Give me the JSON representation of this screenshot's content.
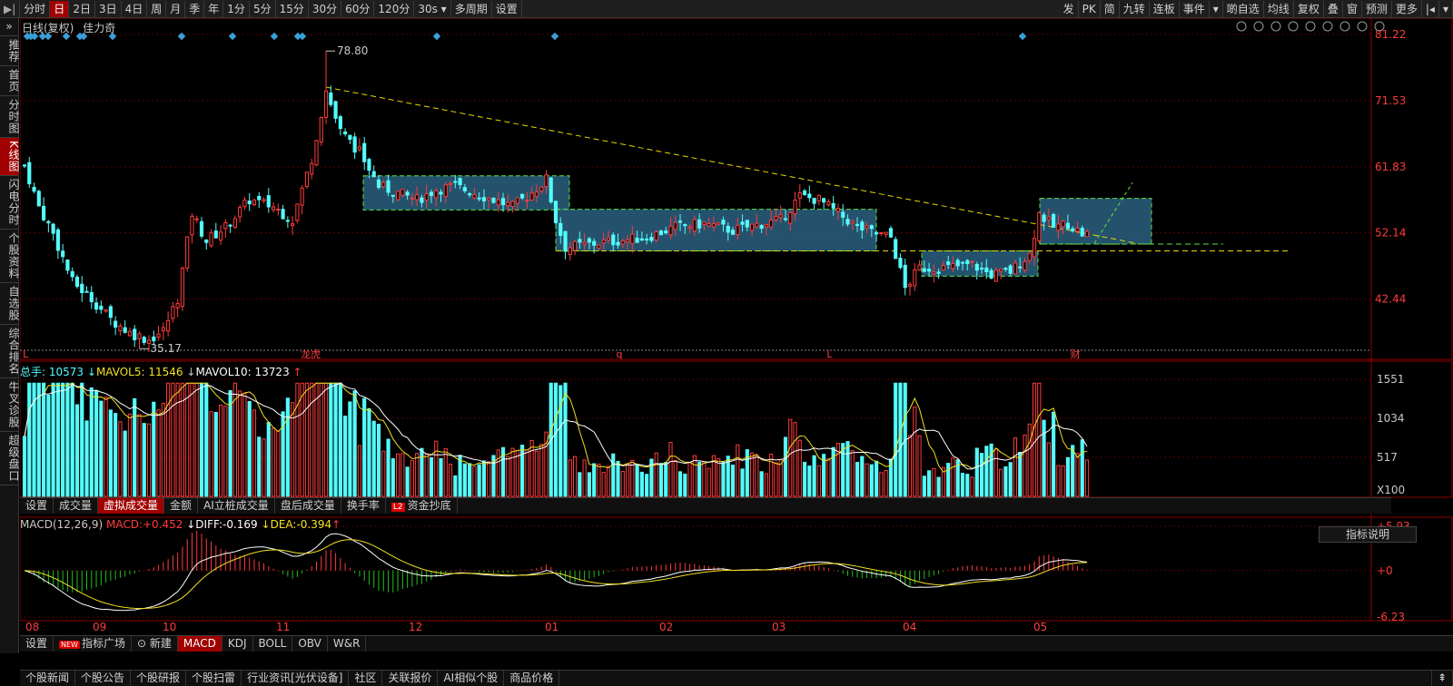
{
  "toolbar": {
    "left": [
      "分时",
      "日",
      "2日",
      "3日",
      "4日",
      "周",
      "月",
      "季",
      "年",
      "1分",
      "5分",
      "15分",
      "30分",
      "60分",
      "120分",
      "30s ▾",
      "多周期",
      "设置"
    ],
    "active": "日",
    "right": [
      "发",
      "PK",
      "简",
      "九转",
      "连板",
      "事件",
      "▾",
      "啲自选",
      "均线",
      "复权",
      "叠",
      "窗",
      "预测",
      "更多",
      "|◂",
      "▾"
    ]
  },
  "sidebar": [
    {
      "label": "推荐"
    },
    {
      "label": "首页"
    },
    {
      "label": "分时图"
    },
    {
      "label": "K线图",
      "active": true
    },
    {
      "label": "闪电分时"
    },
    {
      "label": "个股资料"
    },
    {
      "label": "自选股"
    },
    {
      "label": "综合排名"
    },
    {
      "label": "牛叉诊股"
    },
    {
      "label": "超级盘口"
    }
  ],
  "header": {
    "mode": "日线(复权)",
    "stock": "佳力奇"
  },
  "header_icons": [
    "settings-icon",
    "brush-icon",
    "eye-icon",
    "headset-icon",
    "copy-icon",
    "lock-icon",
    "zoom-in-icon",
    "zoom-out-icon",
    "close-icon"
  ],
  "price_axis": [
    "81.22",
    "71.53",
    "61.83",
    "52.14",
    "42.44"
  ],
  "markers": {
    "high": "78.80",
    "low": "35.17"
  },
  "event_labels": [
    {
      "x": 0.002,
      "t": "L"
    },
    {
      "x": 0.196,
      "t": "龙虎"
    },
    {
      "x": 0.416,
      "t": "q"
    },
    {
      "x": 0.563,
      "t": "L"
    },
    {
      "x": 0.733,
      "t": "财"
    }
  ],
  "volume": {
    "label": "总手: 10573",
    "mavol5_label": "MAVOL5:",
    "mavol5": "11546",
    "mavol10_label": "MAVOL10:",
    "mavol10": "13723",
    "axis": [
      "1551",
      "1034",
      "517"
    ],
    "unit": "X100"
  },
  "vol_tabs": [
    "设置",
    "成交量",
    "虚拟成交量",
    "金额",
    "AI立桩成交量",
    "盘后成交量",
    "换手率",
    "资金抄底"
  ],
  "vol_tab_active": "虚拟成交量",
  "l2_tag": "L2",
  "macd": {
    "label": "MACD(12,26,9)",
    "macd_label": "MACD:",
    "macd": "+0.452",
    "diff_label": "DIFF:",
    "diff": "-0.169",
    "dea_label": "DEA:",
    "dea": "-0.394",
    "axis": [
      "+5.93",
      "+0",
      "-6.23"
    ]
  },
  "explain_button": "指标说明",
  "months": [
    "08",
    "09",
    "10",
    "11",
    "12",
    "01",
    "02",
    "03",
    "04",
    "05"
  ],
  "ind_tabs": [
    "设置",
    "指标广场",
    "新建",
    "MACD",
    "KDJ",
    "BOLL",
    "OBV",
    "W&R"
  ],
  "ind_tab_active": "MACD",
  "new_tag": "NEW",
  "bottom_tabs": [
    "个股新闻",
    "个股公告",
    "个股研报",
    "个股扫雷",
    "行业资讯[光伏设备]",
    "社区",
    "关联报价",
    "AI相似个股",
    "商品价格"
  ],
  "colors": {
    "up": "#ff3b3b",
    "down": "#54fcfc",
    "ma5": "#ffffff",
    "ma10": "#f0e020",
    "box": "#2a6080",
    "boxline": "#60e040",
    "trend": "#e8d800",
    "marker": "#3a9fd8"
  },
  "chart_data": {
    "type": "candlestick",
    "x": [
      "08",
      "09",
      "10",
      "11",
      "12",
      "01",
      "02",
      "03",
      "04",
      "05"
    ],
    "ylim": [
      35.17,
      81.22
    ],
    "annotations": {
      "high": 78.8,
      "low": 35.17
    },
    "volume_ylim": [
      0,
      1551
    ],
    "macd_ylim": [
      -6.23,
      5.93
    ],
    "keypoints": [
      {
        "i": 0,
        "p": 62
      },
      {
        "i": 3,
        "p": 56
      },
      {
        "i": 6,
        "p": 52
      },
      {
        "i": 10,
        "p": 45
      },
      {
        "i": 14,
        "p": 42.5
      },
      {
        "i": 18,
        "p": 39.5
      },
      {
        "i": 22,
        "p": 37.5
      },
      {
        "i": 26,
        "p": 36.5
      },
      {
        "i": 29,
        "p": 37.8
      },
      {
        "i": 32,
        "p": 42.5
      },
      {
        "i": 35,
        "p": 55
      },
      {
        "i": 38,
        "p": 51
      },
      {
        "i": 42,
        "p": 53
      },
      {
        "i": 47,
        "p": 57
      },
      {
        "i": 52,
        "p": 56
      },
      {
        "i": 56,
        "p": 54
      },
      {
        "i": 60,
        "p": 63
      },
      {
        "i": 63,
        "p": 73
      },
      {
        "i": 66,
        "p": 67
      },
      {
        "i": 70,
        "p": 64
      },
      {
        "i": 74,
        "p": 59
      },
      {
        "i": 78,
        "p": 58
      },
      {
        "i": 82,
        "p": 57
      },
      {
        "i": 86,
        "p": 58.5
      },
      {
        "i": 90,
        "p": 59
      },
      {
        "i": 94,
        "p": 58
      },
      {
        "i": 98,
        "p": 57
      },
      {
        "i": 102,
        "p": 56
      },
      {
        "i": 106,
        "p": 58
      },
      {
        "i": 109,
        "p": 60
      },
      {
        "i": 111,
        "p": 54
      },
      {
        "i": 113,
        "p": 50
      },
      {
        "i": 118,
        "p": 50.5
      },
      {
        "i": 124,
        "p": 51
      },
      {
        "i": 130,
        "p": 51.5
      },
      {
        "i": 136,
        "p": 53
      },
      {
        "i": 142,
        "p": 53.5
      },
      {
        "i": 148,
        "p": 52.5
      },
      {
        "i": 154,
        "p": 53.5
      },
      {
        "i": 158,
        "p": 54
      },
      {
        "i": 162,
        "p": 57.5
      },
      {
        "i": 166,
        "p": 57
      },
      {
        "i": 170,
        "p": 55
      },
      {
        "i": 174,
        "p": 53
      },
      {
        "i": 178,
        "p": 52
      },
      {
        "i": 181,
        "p": 51.5
      },
      {
        "i": 184,
        "p": 44
      },
      {
        "i": 187,
        "p": 47
      },
      {
        "i": 192,
        "p": 47
      },
      {
        "i": 198,
        "p": 47.5
      },
      {
        "i": 202,
        "p": 46
      },
      {
        "i": 206,
        "p": 46.5
      },
      {
        "i": 210,
        "p": 49
      },
      {
        "i": 212,
        "p": 55
      },
      {
        "i": 215,
        "p": 53
      },
      {
        "i": 218,
        "p": 53.5
      },
      {
        "i": 221,
        "p": 52
      }
    ]
  }
}
